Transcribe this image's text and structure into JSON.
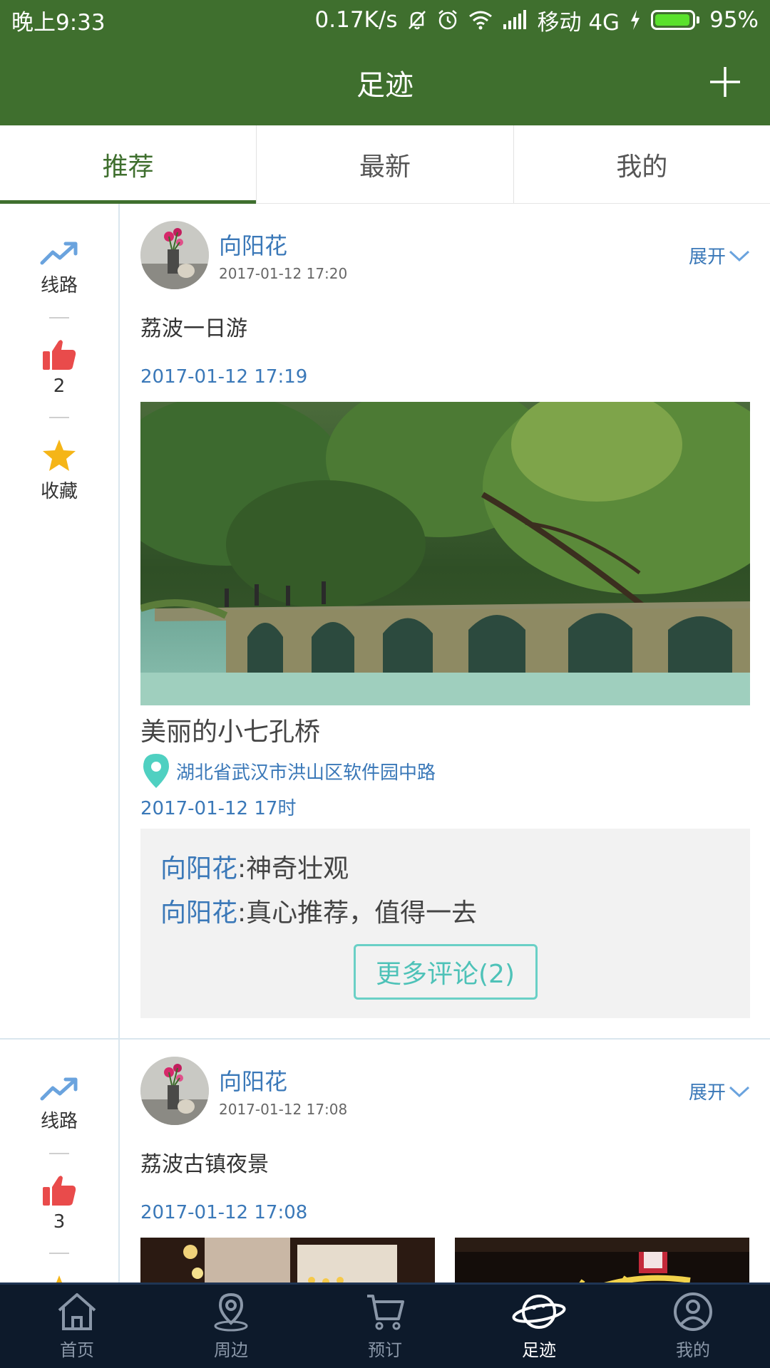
{
  "status_bar": {
    "time": "晚上9:33",
    "net_speed": "0.17K/s",
    "carrier": "移动 4G",
    "battery": "95%",
    "battery_level": 0.95,
    "icons": [
      "mute-bell-icon",
      "alarm-icon",
      "wifi-icon",
      "signal-icon",
      "charging-icon",
      "battery-icon"
    ]
  },
  "header": {
    "title": "足迹",
    "add_icon": "plus-icon"
  },
  "tabs": [
    {
      "label": "推荐",
      "active": true
    },
    {
      "label": "最新",
      "active": false
    },
    {
      "label": "我的",
      "active": false
    }
  ],
  "posts": [
    {
      "side": {
        "route_label": "线路",
        "like_count": "2",
        "fav_label": "收藏"
      },
      "user": "向阳花",
      "time": "2017-01-12 17:20",
      "expand": "展开",
      "title": "荔波一日游",
      "date": "2017-01-12 17:19",
      "caption": "美丽的小七孔桥",
      "location": "湖北省武汉市洪山区软件园中路",
      "loc_date": "2017-01-12 17时",
      "comments": [
        {
          "user": "向阳花",
          "text": ":神奇壮观"
        },
        {
          "user": "向阳花",
          "text": ":真心推荐，值得一去"
        }
      ],
      "more_comments": "更多评论(2)"
    },
    {
      "side": {
        "route_label": "线路",
        "like_count": "3"
      },
      "user": "向阳花",
      "time": "2017-01-12 17:08",
      "expand": "展开",
      "title": "荔波古镇夜景",
      "date": "2017-01-12 17:08"
    }
  ],
  "bottom_nav": [
    {
      "label": "首页",
      "icon": "home-icon",
      "active": false
    },
    {
      "label": "周边",
      "icon": "location-icon",
      "active": false
    },
    {
      "label": "预订",
      "icon": "cart-icon",
      "active": false
    },
    {
      "label": "足迹",
      "icon": "planet-icon",
      "active": true
    },
    {
      "label": "我的",
      "icon": "user-icon",
      "active": false
    }
  ],
  "colors": {
    "brand_green": "#3f6f2e",
    "link_blue": "#3a78b8",
    "teal": "#4ec2b8",
    "nav_bg": "#0d1a2b"
  }
}
